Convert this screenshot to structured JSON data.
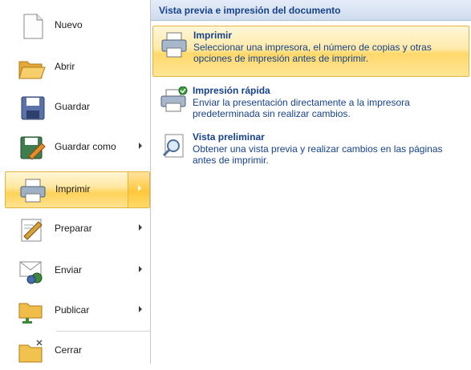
{
  "left_menu": {
    "items": [
      {
        "label": "Nuevo",
        "icon": "new-document-icon"
      },
      {
        "label": "Abrir",
        "icon": "open-folder-icon"
      },
      {
        "label": "Guardar",
        "icon": "save-icon"
      },
      {
        "label": "Guardar como",
        "icon": "save-as-icon"
      },
      {
        "label": "Imprimir",
        "icon": "printer-icon"
      },
      {
        "label": "Preparar",
        "icon": "prepare-icon"
      },
      {
        "label": "Enviar",
        "icon": "send-icon"
      },
      {
        "label": "Publicar",
        "icon": "publish-icon"
      },
      {
        "label": "Cerrar",
        "icon": "close-folder-icon"
      }
    ]
  },
  "panel": {
    "title": "Vista previa e impresión del documento",
    "options": [
      {
        "title": "Imprimir",
        "description": "Seleccionar una impresora, el número de copias y otras opciones de impresión antes de imprimir.",
        "icon": "printer-icon"
      },
      {
        "title": "Impresión rápida",
        "description": "Enviar la presentación directamente a la impresora predeterminada sin realizar cambios.",
        "icon": "quick-print-icon"
      },
      {
        "title": "Vista preliminar",
        "description": "Obtener una vista previa y realizar cambios en las páginas antes de imprimir.",
        "icon": "print-preview-icon"
      }
    ]
  }
}
